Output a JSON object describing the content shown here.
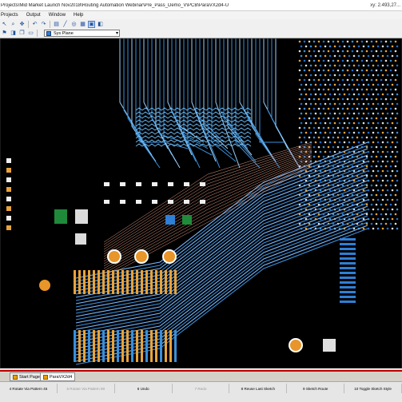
{
  "window": {
    "title": "Projects\\Mid Market Launch Nov2018\\Routing Automation Webinar\\Pre_Pass_Demo_V\\PCB\\ParaVX2d4-U",
    "coordinates": "xy: 2.493,27..."
  },
  "menu": [
    "Projects",
    "Output",
    "Window",
    "Help"
  ],
  "toolbar": {
    "layer_label": "Sys Plane",
    "icons": [
      "select-icon",
      "zoom-icon",
      "pan-icon",
      "undo-icon",
      "redo-icon",
      "layer-icon",
      "route-icon",
      "via-icon",
      "grid-icon",
      "highlight-icon",
      "display-icon",
      "flag-icon",
      "view-icon",
      "copy-icon",
      "board-icon"
    ]
  },
  "doc_tabs": [
    "Start Page",
    "ParaVX2d4"
  ],
  "fkeys": [
    {
      "label": "4 Rotate Via Pattern 45",
      "enabled": true
    },
    {
      "label": "5 Rotate Via Pattern 90",
      "enabled": false
    },
    {
      "label": "6 Undo",
      "enabled": true
    },
    {
      "label": "7 Redo",
      "enabled": false
    },
    {
      "label": "8 Reuse Last Sketch",
      "enabled": true
    },
    {
      "label": "9 Sketch Route",
      "enabled": true
    },
    {
      "label": "10 Toggle Sketch Style",
      "enabled": true
    }
  ],
  "colors": {
    "canvas": "#000000",
    "trace_blue": "#3a8fd9",
    "trace_pad": "#e8a33a",
    "component_green": "#1f8a3a",
    "status_red": "#c00000"
  }
}
